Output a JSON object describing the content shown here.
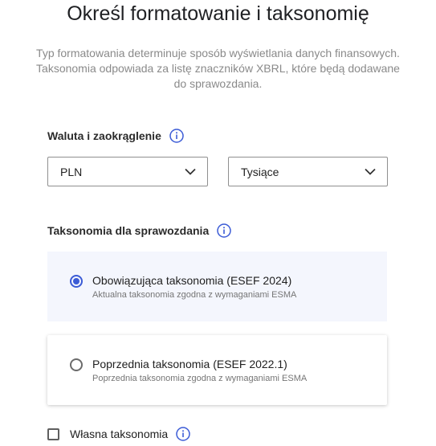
{
  "header": {
    "title": "Określ formatowanie i taksonomię",
    "description": "Typ formatowania determinuje sposób wyświetlania danych finansowych. Taksonomia odpowiada za listę znaczników XBRL, które będą dodawane do sprawozdania."
  },
  "currency_section": {
    "label": "Waluta i zaokrąglenie",
    "currency_select": {
      "value": "PLN",
      "icon": "chevron-down-icon"
    },
    "rounding_select": {
      "value": "Tysiące",
      "icon": "chevron-down-icon"
    }
  },
  "taxonomy_section": {
    "label": "Taksonomia dla sprawozdania",
    "options": [
      {
        "title": "Obowiązująca taksonomia (ESEF 2024)",
        "subtitle": "Aktualna taksonomia zgodna z wymaganiami ESMA",
        "selected": true
      },
      {
        "title": "Poprzednia taksonomia (ESEF 2022.1)",
        "subtitle": "Poprzednia taksonomia zgodna z wymaganiami ESMA",
        "selected": false
      }
    ]
  },
  "custom_taxonomy": {
    "label": "Własna taksonomia",
    "checked": false
  },
  "colors": {
    "accent": "#3b5bd6",
    "selected_card_bg": "#f4f6fd",
    "description_text": "#8a8a8a"
  }
}
